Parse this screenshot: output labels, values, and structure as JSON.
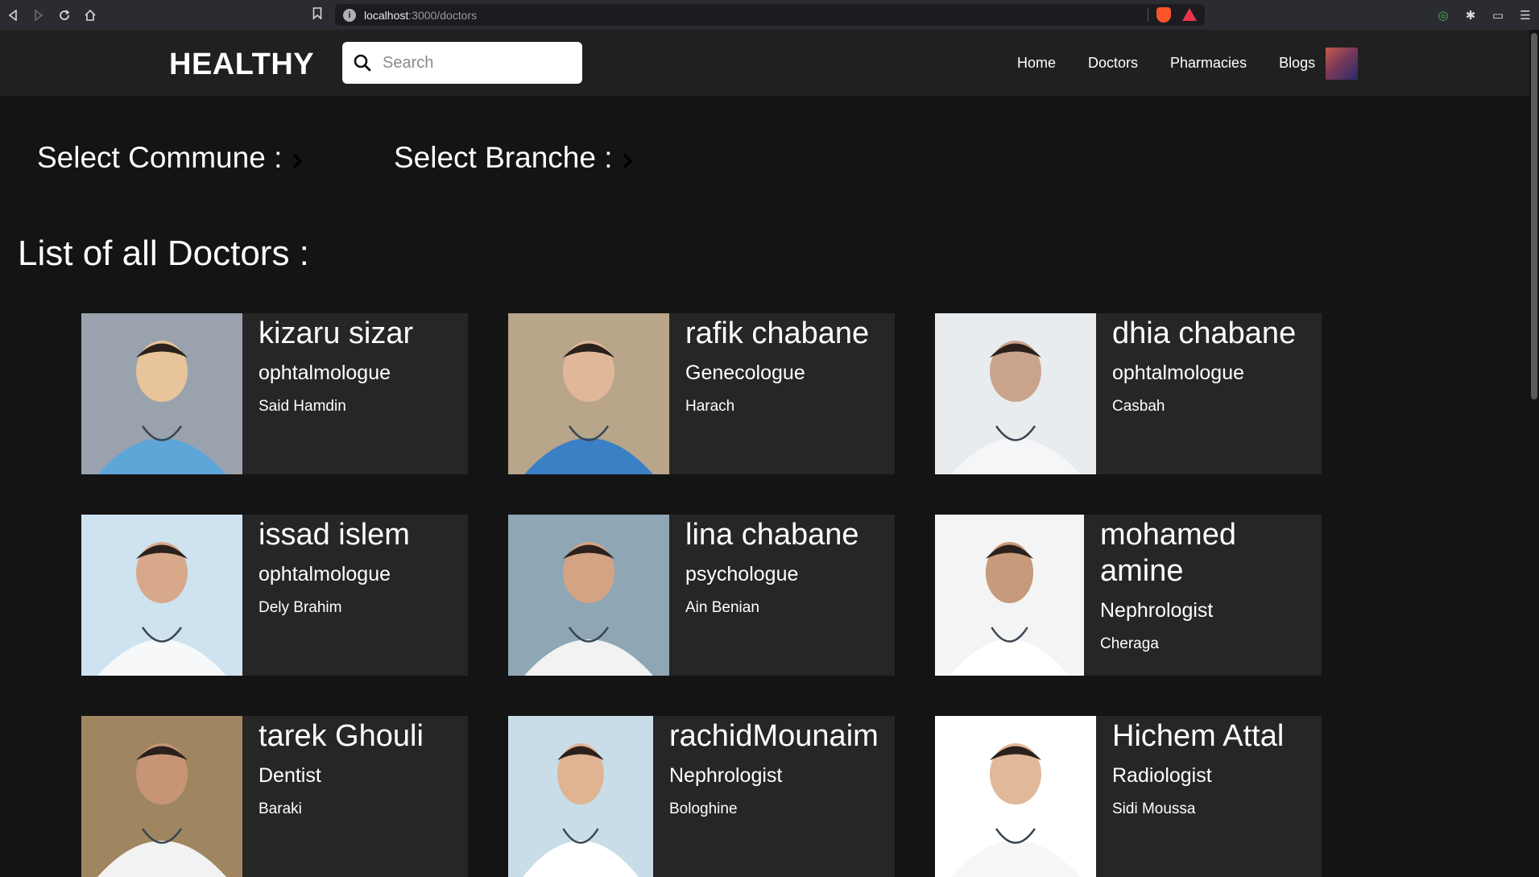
{
  "browser": {
    "url_host": "localhost",
    "url_path": ":3000/doctors"
  },
  "header": {
    "logo": "HEALTHY",
    "search_placeholder": "Search",
    "nav": [
      "Home",
      "Doctors",
      "Pharmacies",
      "Blogs"
    ]
  },
  "filters": {
    "commune_label": "Select Commune :",
    "branche_label": "Select Branche :"
  },
  "list_title": "List of all Doctors :",
  "doctors": [
    {
      "name": "kizaru sizar",
      "specialty": "ophtalmologue",
      "commune": "Said Hamdin"
    },
    {
      "name": "rafik chabane",
      "specialty": "Genecologue",
      "commune": "Harach"
    },
    {
      "name": "dhia chabane",
      "specialty": "ophtalmologue",
      "commune": "Casbah"
    },
    {
      "name": "issad islem",
      "specialty": "ophtalmologue",
      "commune": "Dely Brahim"
    },
    {
      "name": "lina chabane",
      "specialty": "psychologue",
      "commune": "Ain Benian"
    },
    {
      "name": "mohamed amine",
      "specialty": "Nephrologist",
      "commune": "Cheraga"
    },
    {
      "name": "tarek Ghouli",
      "specialty": "Dentist",
      "commune": "Baraki"
    },
    {
      "name": "rachidMounaim",
      "specialty": "Nephrologist",
      "commune": "Bologhine"
    },
    {
      "name": "Hichem Attal",
      "specialty": "Radiologist",
      "commune": "Sidi Moussa"
    }
  ]
}
